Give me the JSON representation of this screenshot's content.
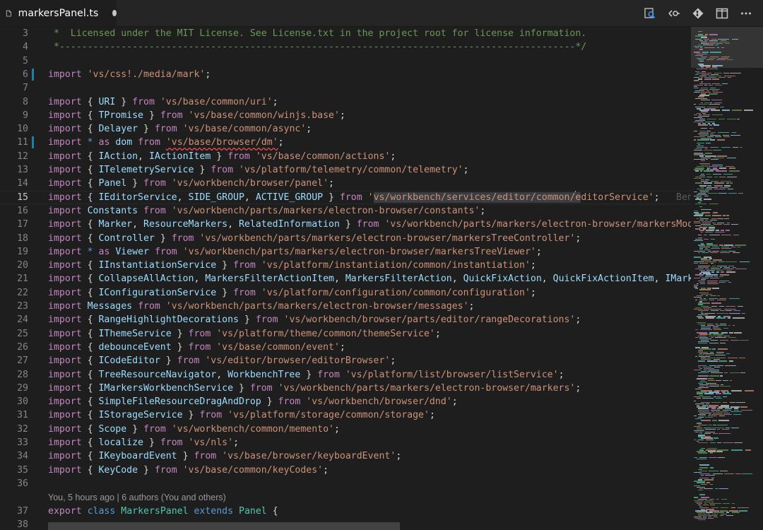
{
  "tab": {
    "title": "markersPanel.ts",
    "dirty": true
  },
  "toolbar": {
    "icons": [
      "open-changes-icon",
      "toggle-whitespace-icon",
      "git-compare-icon",
      "split-editor-icon",
      "more-actions-icon"
    ]
  },
  "colors": {
    "keyword": "#c586c0",
    "keyword_blue": "#569cd6",
    "string": "#ce9178",
    "identifier": "#9cdcfe",
    "class": "#4ec9b0",
    "comment": "#6a9955",
    "modified_gutter": "#1b81a8"
  },
  "codelens": {
    "text": "You, 5 hours ago | 6 authors (You and others)"
  },
  "blame": {
    "text": "Ben"
  },
  "lines": [
    {
      "n": "3",
      "tokens": [
        [
          "cmt",
          " *  Licensed under the MIT License. See License.txt in the project root for license information."
        ]
      ]
    },
    {
      "n": "4",
      "tokens": [
        [
          "cmt",
          " *--------------------------------------------------------------------------------------------*/"
        ]
      ]
    },
    {
      "n": "5",
      "tokens": []
    },
    {
      "n": "6",
      "mark": true,
      "tokens": [
        [
          "kw",
          "import"
        ],
        [
          "pun",
          " "
        ],
        [
          "str",
          "'vs/css!./media/mark'"
        ],
        [
          "pun",
          ";"
        ]
      ]
    },
    {
      "n": "7",
      "tokens": []
    },
    {
      "n": "8",
      "tokens": [
        [
          "kw",
          "import"
        ],
        [
          "pun",
          " { "
        ],
        [
          "id",
          "URI"
        ],
        [
          "pun",
          " } "
        ],
        [
          "kw",
          "from"
        ],
        [
          "pun",
          " "
        ],
        [
          "str",
          "'vs/base/common/uri'"
        ],
        [
          "pun",
          ";"
        ]
      ]
    },
    {
      "n": "9",
      "tokens": [
        [
          "kw",
          "import"
        ],
        [
          "pun",
          " { "
        ],
        [
          "id",
          "TPromise"
        ],
        [
          "pun",
          " } "
        ],
        [
          "kw",
          "from"
        ],
        [
          "pun",
          " "
        ],
        [
          "str",
          "'vs/base/common/winjs.base'"
        ],
        [
          "pun",
          ";"
        ]
      ]
    },
    {
      "n": "10",
      "tokens": [
        [
          "kw",
          "import"
        ],
        [
          "pun",
          " { "
        ],
        [
          "id",
          "Delayer"
        ],
        [
          "pun",
          " } "
        ],
        [
          "kw",
          "from"
        ],
        [
          "pun",
          " "
        ],
        [
          "str",
          "'vs/base/common/async'"
        ],
        [
          "pun",
          ";"
        ]
      ]
    },
    {
      "n": "11",
      "mark": true,
      "tokens": [
        [
          "kw",
          "import"
        ],
        [
          "pun",
          " "
        ],
        [
          "kb",
          "*"
        ],
        [
          "pun",
          " "
        ],
        [
          "kw",
          "as"
        ],
        [
          "pun",
          " "
        ],
        [
          "id",
          "dom"
        ],
        [
          "pun",
          " "
        ],
        [
          "kw",
          "from"
        ],
        [
          "pun",
          " "
        ],
        [
          "strsq",
          "'vs/base/browser/dm'"
        ],
        [
          "pun",
          ";"
        ]
      ]
    },
    {
      "n": "12",
      "tokens": [
        [
          "kw",
          "import"
        ],
        [
          "pun",
          " { "
        ],
        [
          "id",
          "IAction"
        ],
        [
          "pun",
          ", "
        ],
        [
          "id",
          "IActionItem"
        ],
        [
          "pun",
          " } "
        ],
        [
          "kw",
          "from"
        ],
        [
          "pun",
          " "
        ],
        [
          "str",
          "'vs/base/common/actions'"
        ],
        [
          "pun",
          ";"
        ]
      ]
    },
    {
      "n": "13",
      "tokens": [
        [
          "kw",
          "import"
        ],
        [
          "pun",
          " { "
        ],
        [
          "id",
          "ITelemetryService"
        ],
        [
          "pun",
          " } "
        ],
        [
          "kw",
          "from"
        ],
        [
          "pun",
          " "
        ],
        [
          "str",
          "'vs/platform/telemetry/common/telemetry'"
        ],
        [
          "pun",
          ";"
        ]
      ]
    },
    {
      "n": "14",
      "tokens": [
        [
          "kw",
          "import"
        ],
        [
          "pun",
          " { "
        ],
        [
          "id",
          "Panel"
        ],
        [
          "pun",
          " } "
        ],
        [
          "kw",
          "from"
        ],
        [
          "pun",
          " "
        ],
        [
          "str",
          "'vs/workbench/browser/panel'"
        ],
        [
          "pun",
          ";"
        ]
      ]
    },
    {
      "n": "15",
      "active": true,
      "blame": true,
      "tokens": [
        [
          "kw",
          "import"
        ],
        [
          "pun",
          " { "
        ],
        [
          "id",
          "IEditorService"
        ],
        [
          "pun",
          ", "
        ],
        [
          "id",
          "SIDE_GROUP"
        ],
        [
          "pun",
          ", "
        ],
        [
          "id",
          "ACTIVE_GROUP"
        ],
        [
          "pun",
          " } "
        ],
        [
          "kw",
          "from"
        ],
        [
          "pun",
          " "
        ],
        [
          "str",
          "'"
        ],
        [
          "strsel",
          "vs/workbench/services/editor/common/"
        ],
        [
          "cursor",
          ""
        ],
        [
          "strsel",
          "e"
        ],
        [
          "str",
          "ditorService'"
        ],
        [
          "pun",
          ";"
        ]
      ]
    },
    {
      "n": "16",
      "tokens": [
        [
          "kw",
          "import"
        ],
        [
          "pun",
          " "
        ],
        [
          "id",
          "Constants"
        ],
        [
          "pun",
          " "
        ],
        [
          "kw",
          "from"
        ],
        [
          "pun",
          " "
        ],
        [
          "str",
          "'vs/workbench/parts/markers/electron-browser/constants'"
        ],
        [
          "pun",
          ";"
        ]
      ]
    },
    {
      "n": "17",
      "tokens": [
        [
          "kw",
          "import"
        ],
        [
          "pun",
          " { "
        ],
        [
          "id",
          "Marker"
        ],
        [
          "pun",
          ", "
        ],
        [
          "id",
          "ResourceMarkers"
        ],
        [
          "pun",
          ", "
        ],
        [
          "id",
          "RelatedInformation"
        ],
        [
          "pun",
          " } "
        ],
        [
          "kw",
          "from"
        ],
        [
          "pun",
          " "
        ],
        [
          "str",
          "'vs/workbench/parts/markers/electron-browser/markersModel'"
        ]
      ]
    },
    {
      "n": "18",
      "tokens": [
        [
          "kw",
          "import"
        ],
        [
          "pun",
          " { "
        ],
        [
          "id",
          "Controller"
        ],
        [
          "pun",
          " } "
        ],
        [
          "kw",
          "from"
        ],
        [
          "pun",
          " "
        ],
        [
          "str",
          "'vs/workbench/parts/markers/electron-browser/markersTreeController'"
        ],
        [
          "pun",
          ";"
        ]
      ]
    },
    {
      "n": "19",
      "tokens": [
        [
          "kw",
          "import"
        ],
        [
          "pun",
          " "
        ],
        [
          "kb",
          "*"
        ],
        [
          "pun",
          " "
        ],
        [
          "kw",
          "as"
        ],
        [
          "pun",
          " "
        ],
        [
          "id",
          "Viewer"
        ],
        [
          "pun",
          " "
        ],
        [
          "kw",
          "from"
        ],
        [
          "pun",
          " "
        ],
        [
          "str",
          "'vs/workbench/parts/markers/electron-browser/markersTreeViewer'"
        ],
        [
          "pun",
          ";"
        ]
      ]
    },
    {
      "n": "20",
      "tokens": [
        [
          "kw",
          "import"
        ],
        [
          "pun",
          " { "
        ],
        [
          "id",
          "IInstantiationService"
        ],
        [
          "pun",
          " } "
        ],
        [
          "kw",
          "from"
        ],
        [
          "pun",
          " "
        ],
        [
          "str",
          "'vs/platform/instantiation/common/instantiation'"
        ],
        [
          "pun",
          ";"
        ]
      ]
    },
    {
      "n": "21",
      "tokens": [
        [
          "kw",
          "import"
        ],
        [
          "pun",
          " { "
        ],
        [
          "id",
          "CollapseAllAction"
        ],
        [
          "pun",
          ", "
        ],
        [
          "id",
          "MarkersFilterActionItem"
        ],
        [
          "pun",
          ", "
        ],
        [
          "id",
          "MarkersFilterAction"
        ],
        [
          "pun",
          ", "
        ],
        [
          "id",
          "QuickFixAction"
        ],
        [
          "pun",
          ", "
        ],
        [
          "id",
          "QuickFixActionItem"
        ],
        [
          "pun",
          ", "
        ],
        [
          "id",
          "IMarkers"
        ]
      ]
    },
    {
      "n": "22",
      "tokens": [
        [
          "kw",
          "import"
        ],
        [
          "pun",
          " { "
        ],
        [
          "id",
          "IConfigurationService"
        ],
        [
          "pun",
          " } "
        ],
        [
          "kw",
          "from"
        ],
        [
          "pun",
          " "
        ],
        [
          "str",
          "'vs/platform/configuration/common/configuration'"
        ],
        [
          "pun",
          ";"
        ]
      ]
    },
    {
      "n": "23",
      "tokens": [
        [
          "kw",
          "import"
        ],
        [
          "pun",
          " "
        ],
        [
          "id",
          "Messages"
        ],
        [
          "pun",
          " "
        ],
        [
          "kw",
          "from"
        ],
        [
          "pun",
          " "
        ],
        [
          "str",
          "'vs/workbench/parts/markers/electron-browser/messages'"
        ],
        [
          "pun",
          ";"
        ]
      ]
    },
    {
      "n": "24",
      "tokens": [
        [
          "kw",
          "import"
        ],
        [
          "pun",
          " { "
        ],
        [
          "id",
          "RangeHighlightDecorations"
        ],
        [
          "pun",
          " } "
        ],
        [
          "kw",
          "from"
        ],
        [
          "pun",
          " "
        ],
        [
          "str",
          "'vs/workbench/browser/parts/editor/rangeDecorations'"
        ],
        [
          "pun",
          ";"
        ]
      ]
    },
    {
      "n": "25",
      "tokens": [
        [
          "kw",
          "import"
        ],
        [
          "pun",
          " { "
        ],
        [
          "id",
          "IThemeService"
        ],
        [
          "pun",
          " } "
        ],
        [
          "kw",
          "from"
        ],
        [
          "pun",
          " "
        ],
        [
          "str",
          "'vs/platform/theme/common/themeService'"
        ],
        [
          "pun",
          ";"
        ]
      ]
    },
    {
      "n": "26",
      "tokens": [
        [
          "kw",
          "import"
        ],
        [
          "pun",
          " { "
        ],
        [
          "id",
          "debounceEvent"
        ],
        [
          "pun",
          " } "
        ],
        [
          "kw",
          "from"
        ],
        [
          "pun",
          " "
        ],
        [
          "str",
          "'vs/base/common/event'"
        ],
        [
          "pun",
          ";"
        ]
      ]
    },
    {
      "n": "27",
      "tokens": [
        [
          "kw",
          "import"
        ],
        [
          "pun",
          " { "
        ],
        [
          "id",
          "ICodeEditor"
        ],
        [
          "pun",
          " } "
        ],
        [
          "kw",
          "from"
        ],
        [
          "pun",
          " "
        ],
        [
          "str",
          "'vs/editor/browser/editorBrowser'"
        ],
        [
          "pun",
          ";"
        ]
      ]
    },
    {
      "n": "28",
      "tokens": [
        [
          "kw",
          "import"
        ],
        [
          "pun",
          " { "
        ],
        [
          "id",
          "TreeResourceNavigator"
        ],
        [
          "pun",
          ", "
        ],
        [
          "id",
          "WorkbenchTree"
        ],
        [
          "pun",
          " } "
        ],
        [
          "kw",
          "from"
        ],
        [
          "pun",
          " "
        ],
        [
          "str",
          "'vs/platform/list/browser/listService'"
        ],
        [
          "pun",
          ";"
        ]
      ]
    },
    {
      "n": "29",
      "tokens": [
        [
          "kw",
          "import"
        ],
        [
          "pun",
          " { "
        ],
        [
          "id",
          "IMarkersWorkbenchService"
        ],
        [
          "pun",
          " } "
        ],
        [
          "kw",
          "from"
        ],
        [
          "pun",
          " "
        ],
        [
          "str",
          "'vs/workbench/parts/markers/electron-browser/markers'"
        ],
        [
          "pun",
          ";"
        ]
      ]
    },
    {
      "n": "30",
      "tokens": [
        [
          "kw",
          "import"
        ],
        [
          "pun",
          " { "
        ],
        [
          "id",
          "SimpleFileResourceDragAndDrop"
        ],
        [
          "pun",
          " } "
        ],
        [
          "kw",
          "from"
        ],
        [
          "pun",
          " "
        ],
        [
          "str",
          "'vs/workbench/browser/dnd'"
        ],
        [
          "pun",
          ";"
        ]
      ]
    },
    {
      "n": "31",
      "tokens": [
        [
          "kw",
          "import"
        ],
        [
          "pun",
          " { "
        ],
        [
          "id",
          "IStorageService"
        ],
        [
          "pun",
          " } "
        ],
        [
          "kw",
          "from"
        ],
        [
          "pun",
          " "
        ],
        [
          "str",
          "'vs/platform/storage/common/storage'"
        ],
        [
          "pun",
          ";"
        ]
      ]
    },
    {
      "n": "32",
      "tokens": [
        [
          "kw",
          "import"
        ],
        [
          "pun",
          " { "
        ],
        [
          "id",
          "Scope"
        ],
        [
          "pun",
          " } "
        ],
        [
          "kw",
          "from"
        ],
        [
          "pun",
          " "
        ],
        [
          "str",
          "'vs/workbench/common/memento'"
        ],
        [
          "pun",
          ";"
        ]
      ]
    },
    {
      "n": "33",
      "tokens": [
        [
          "kw",
          "import"
        ],
        [
          "pun",
          " { "
        ],
        [
          "id",
          "localize"
        ],
        [
          "pun",
          " } "
        ],
        [
          "kw",
          "from"
        ],
        [
          "pun",
          " "
        ],
        [
          "str",
          "'vs/nls'"
        ],
        [
          "pun",
          ";"
        ]
      ]
    },
    {
      "n": "34",
      "tokens": [
        [
          "kw",
          "import"
        ],
        [
          "pun",
          " { "
        ],
        [
          "id",
          "IKeyboardEvent"
        ],
        [
          "pun",
          " } "
        ],
        [
          "kw",
          "from"
        ],
        [
          "pun",
          " "
        ],
        [
          "str",
          "'vs/base/browser/keyboardEvent'"
        ],
        [
          "pun",
          ";"
        ]
      ]
    },
    {
      "n": "35",
      "tokens": [
        [
          "kw",
          "import"
        ],
        [
          "pun",
          " { "
        ],
        [
          "id",
          "KeyCode"
        ],
        [
          "pun",
          " } "
        ],
        [
          "kw",
          "from"
        ],
        [
          "pun",
          " "
        ],
        [
          "str",
          "'vs/base/common/keyCodes'"
        ],
        [
          "pun",
          ";"
        ]
      ]
    },
    {
      "n": "36",
      "tokens": []
    },
    {
      "n": "37",
      "lensBefore": true,
      "tokens": [
        [
          "kw",
          "export"
        ],
        [
          "pun",
          " "
        ],
        [
          "kb",
          "class"
        ],
        [
          "pun",
          " "
        ],
        [
          "cls",
          "MarkersPanel"
        ],
        [
          "pun",
          " "
        ],
        [
          "kb",
          "extends"
        ],
        [
          "pun",
          " "
        ],
        [
          "cls",
          "Panel"
        ],
        [
          "pun",
          " {"
        ]
      ]
    },
    {
      "n": "38",
      "tokens": []
    }
  ]
}
